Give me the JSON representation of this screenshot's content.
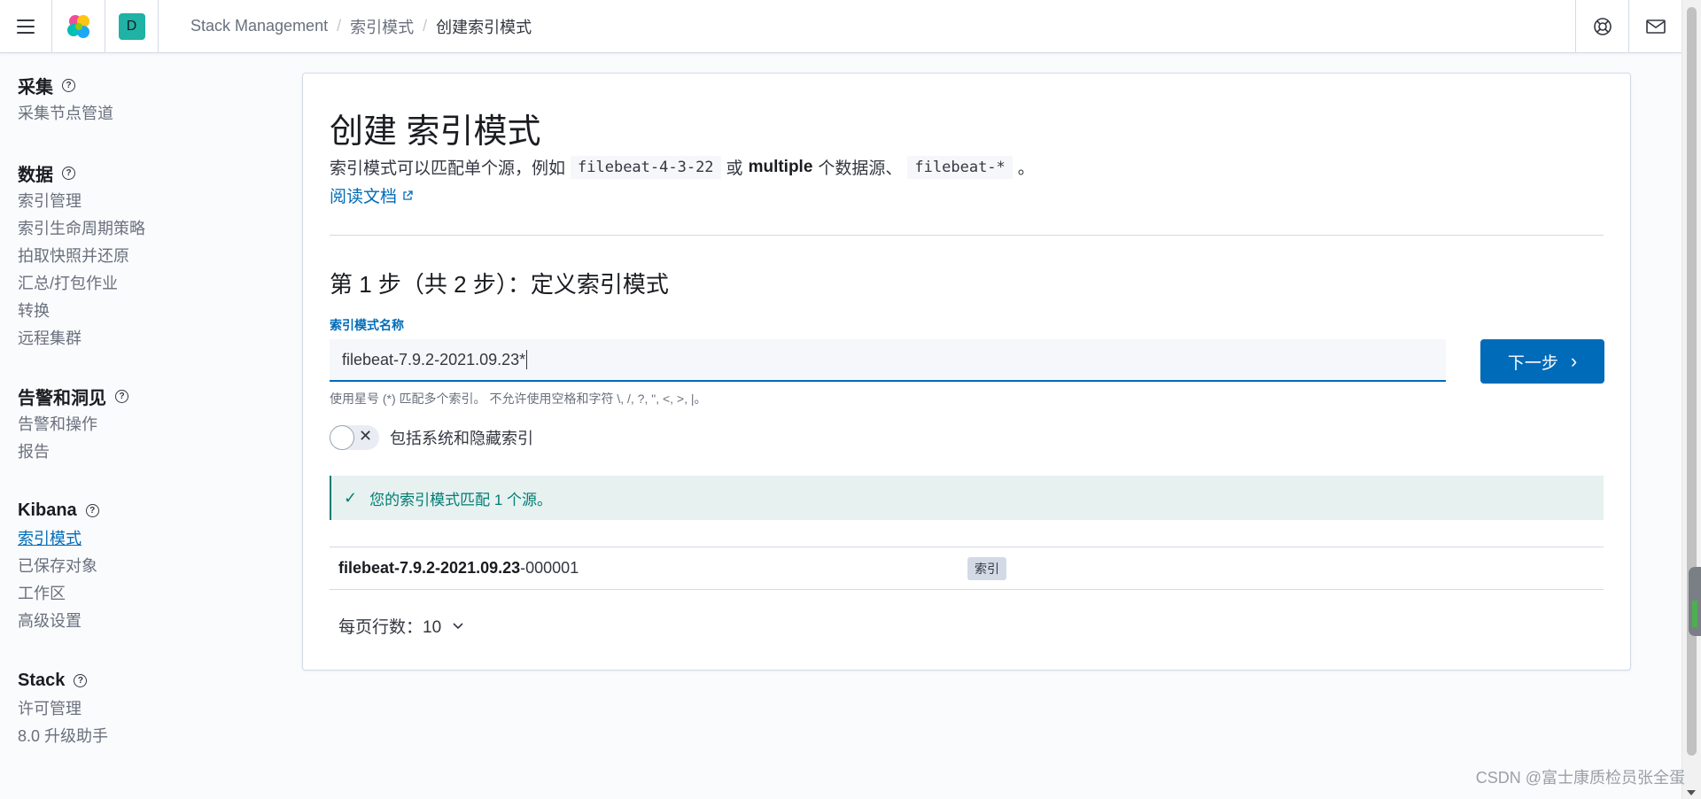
{
  "header": {
    "space_initial": "D",
    "breadcrumbs": [
      "Stack Management",
      "索引模式",
      "创建索引模式"
    ]
  },
  "sidebar": {
    "groups": [
      {
        "title": "采集",
        "items": [
          "采集节点管道"
        ]
      },
      {
        "title": "数据",
        "items": [
          "索引管理",
          "索引生命周期策略",
          "拍取快照并还原",
          "汇总/打包作业",
          "转换",
          "远程集群"
        ]
      },
      {
        "title": "告警和洞见",
        "items": [
          "告警和操作",
          "报告"
        ]
      },
      {
        "title": "Kibana",
        "items": [
          "索引模式",
          "已保存对象",
          "工作区",
          "高级设置"
        ]
      },
      {
        "title": "Stack",
        "items": [
          "许可管理",
          "8.0 升级助手"
        ]
      }
    ],
    "active_item": "索引模式"
  },
  "main": {
    "title": "创建 索引模式",
    "desc_prefix": "索引模式可以匹配单个源，例如",
    "desc_code1": "filebeat-4-3-22",
    "desc_or": "或",
    "desc_multiple": "multiple",
    "desc_middle": "个数据源、",
    "desc_code2": "filebeat-*",
    "desc_end": "。",
    "doc_link": "阅读文档",
    "step_title": "第 1 步（共 2 步）：定义索引模式",
    "field_label": "索引模式名称",
    "field_value": "filebeat-7.9.2-2021.09.23*",
    "next_button": "下一步",
    "help_text": "使用星号 (*) 匹配多个索引。 不允许使用空格和字符 \\, /, ?, \", <, >, |。",
    "toggle_label": "包括系统和隐藏索引",
    "callout_text": "您的索引模式匹配 1 个源。",
    "results": [
      {
        "name_bold": "filebeat-7.9.2-2021.09.23",
        "name_rest": "-000001",
        "badge": "索引"
      }
    ],
    "rows_per_page": "每页行数：10"
  },
  "watermark": "CSDN @富士康质检员张全蛋",
  "colors": {
    "accent": "#006bb8",
    "success": "#017d73",
    "space": "#20b2a5"
  }
}
